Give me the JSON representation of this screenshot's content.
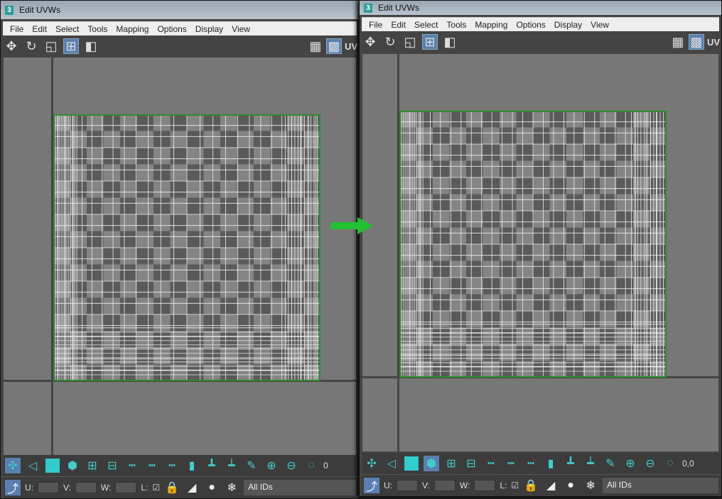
{
  "windows": [
    {
      "id": "left",
      "title": "Edit UVWs"
    },
    {
      "id": "right",
      "title": "Edit UVWs"
    }
  ],
  "app_icon_label": "3",
  "menu": [
    "File",
    "Edit",
    "Select",
    "Tools",
    "Mapping",
    "Options",
    "Display",
    "View"
  ],
  "toolbar": {
    "uv_label": "UV",
    "icons": [
      "move-icon",
      "rotate-icon",
      "scale-icon",
      "freeform-icon",
      "mirror-icon"
    ]
  },
  "bottom": {
    "u_label": "U:",
    "v_label": "V:",
    "w_label": "W:",
    "l_label": "L:",
    "id_filter": "All IDs",
    "value_left": "0",
    "value_right": "0,0"
  },
  "colors": {
    "accent": "#33c4c4",
    "uv_border": "#2e8b2e",
    "arrow": "#22c033",
    "checker_dark": "#5a5a5a",
    "checker_light": "#828282"
  },
  "right_window_selected_tool": "element-select"
}
